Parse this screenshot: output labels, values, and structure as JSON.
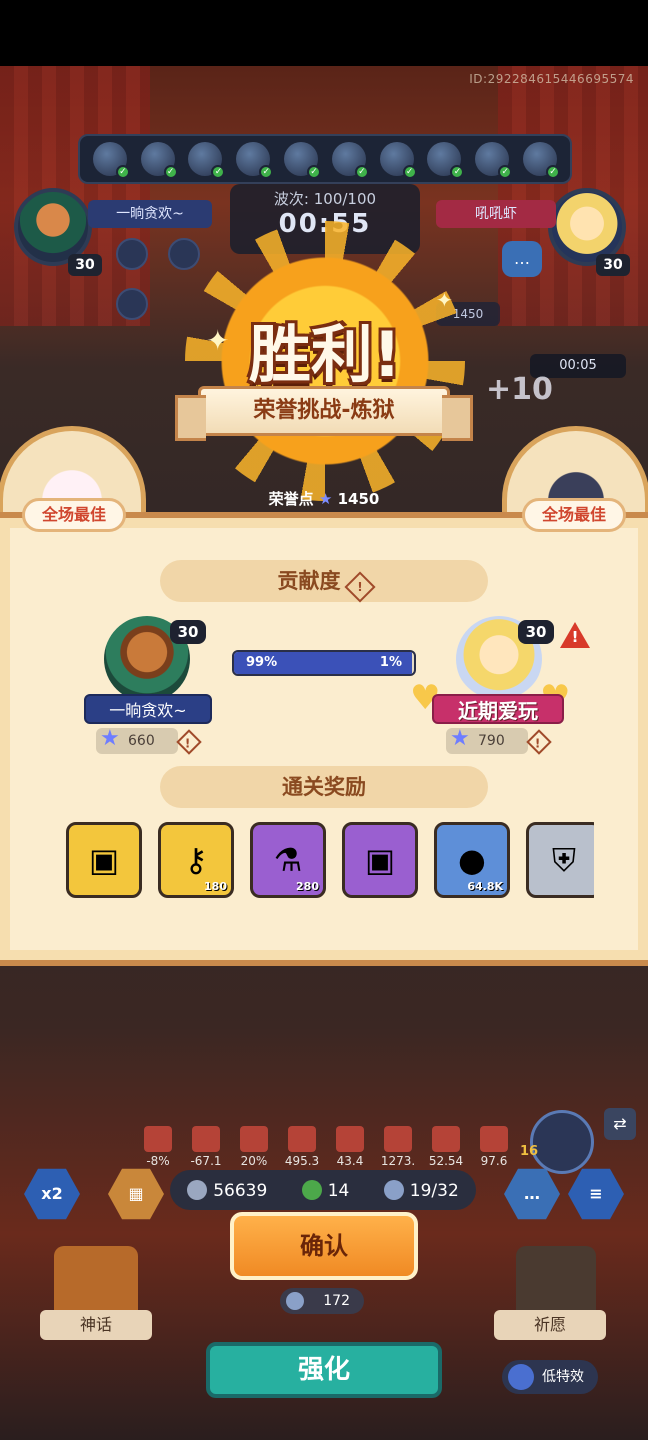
{
  "header": {
    "player_id": "ID:292284615446695574",
    "wave_label": "波次: 100/100",
    "timer": "00:55",
    "left_player_name": "一晌贪欢~",
    "right_player_name": "吼吼虾",
    "left_level": "30",
    "right_level": "30",
    "honor_chip": "1450",
    "small_timer": "00:05",
    "plus_text": "+10"
  },
  "victory": {
    "title": "胜利!",
    "mode": "荣誉挑战-炼狱",
    "honor_label": "荣誉点",
    "honor_value": "1450",
    "mvp_left": "全场最佳",
    "mvp_right": "全场最佳"
  },
  "contribution": {
    "title": "贡献度",
    "left": {
      "level": "30",
      "name": "一晌贪欢~",
      "score": "660"
    },
    "right": {
      "level": "30",
      "name": "近期爱玩",
      "score": "790"
    },
    "left_percent_label": "99%",
    "right_percent_label": "1%",
    "left_fraction": 0.99
  },
  "rewards": {
    "title": "通关奖励",
    "items": [
      {
        "name": "gold-chest",
        "count": "",
        "color": "#f3c63c"
      },
      {
        "name": "gold-key",
        "count": "180",
        "color": "#f3c63c"
      },
      {
        "name": "potion",
        "count": "280",
        "color": "#9a5fd0"
      },
      {
        "name": "purple-chest",
        "count": "",
        "color": "#9a5fd0"
      },
      {
        "name": "gold-coin",
        "count": "64.8K",
        "color": "#5e8fd8"
      },
      {
        "name": "shield-badge",
        "count": "",
        "color": "#b9c0cc"
      }
    ]
  },
  "stats": [
    "-8%",
    "-67.1",
    "20%",
    "495.3",
    "43.4",
    "1273.",
    "52.54",
    "97.6"
  ],
  "resources": {
    "silver": "56639",
    "clover": "14",
    "units": "19/32"
  },
  "actions": {
    "confirm": "确认",
    "cost": "172",
    "enhance": "强化",
    "speed": "x2",
    "myth": "神话",
    "wish": "祈愿",
    "low_fx": "低特效",
    "side_level": "16"
  }
}
